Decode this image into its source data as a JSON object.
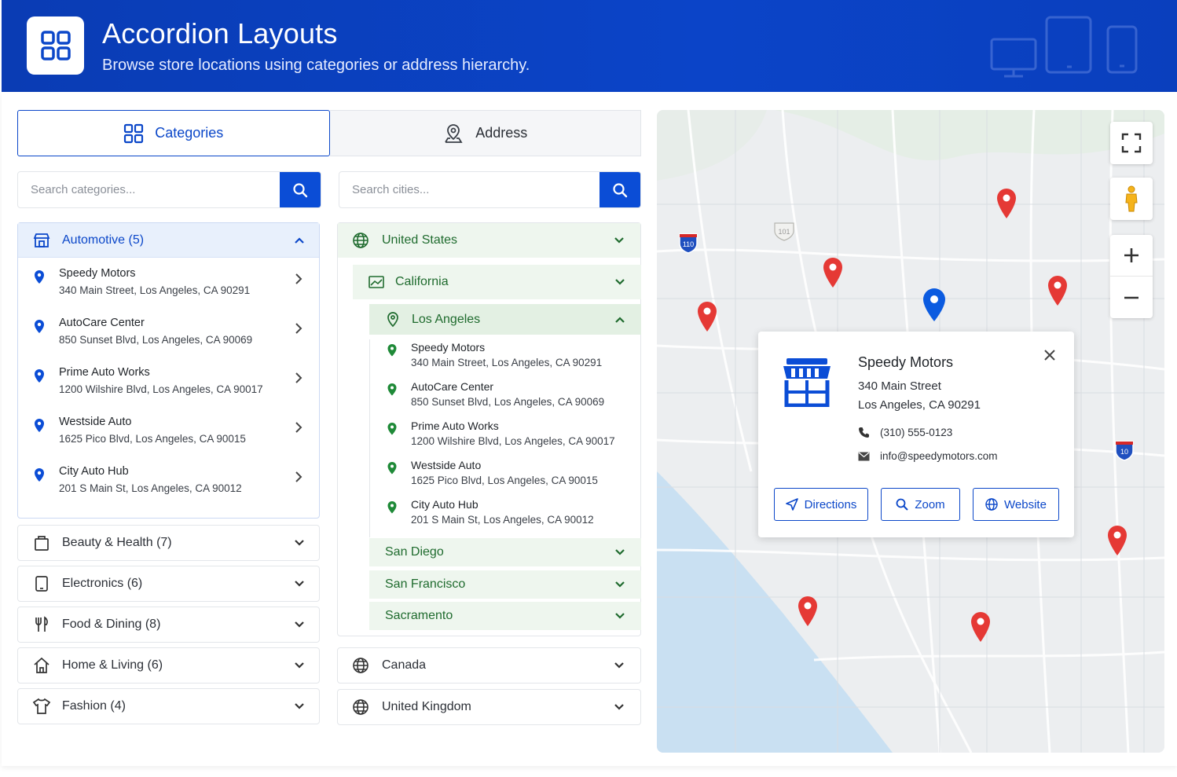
{
  "header": {
    "title": "Accordion Layouts",
    "subtitle": "Browse store locations using categories or address hierarchy."
  },
  "tabs": [
    {
      "label": "Categories",
      "icon": "grid-icon",
      "active": true
    },
    {
      "label": "Address",
      "icon": "location-person-icon",
      "active": false
    }
  ],
  "category_search": {
    "placeholder": "Search categories..."
  },
  "city_search": {
    "placeholder": "Search cities..."
  },
  "categories": [
    {
      "label": "Automotive (5)",
      "icon": "store-icon",
      "open": true,
      "stores": [
        {
          "name": "Speedy Motors",
          "address": "340 Main Street, Los Angeles, CA 90291"
        },
        {
          "name": "AutoCare Center",
          "address": "850 Sunset Blvd, Los Angeles, CA 90069"
        },
        {
          "name": "Prime Auto Works",
          "address": "1200 Wilshire Blvd, Los Angeles, CA 90017"
        },
        {
          "name": "Westside Auto",
          "address": "1625 Pico Blvd, Los Angeles, CA 90015"
        },
        {
          "name": "City Auto Hub",
          "address": "201 S Main St, Los Angeles, CA 90012"
        }
      ]
    },
    {
      "label": "Beauty & Health (7)",
      "icon": "bag-icon"
    },
    {
      "label": "Electronics (6)",
      "icon": "tablet-icon"
    },
    {
      "label": "Food & Dining (8)",
      "icon": "fork-knife-icon"
    },
    {
      "label": "Home & Living (6)",
      "icon": "home-icon"
    },
    {
      "label": "Fashion (4)",
      "icon": "shirt-icon"
    }
  ],
  "address": {
    "country_open": "United States",
    "state_open": "California",
    "city_open": "Los Angeles",
    "city_stores": [
      {
        "name": "Speedy Motors",
        "address": "340 Main Street, Los Angeles, CA 90291"
      },
      {
        "name": "AutoCare Center",
        "address": "850 Sunset Blvd, Los Angeles, CA 90069"
      },
      {
        "name": "Prime Auto Works",
        "address": "1200 Wilshire Blvd, Los Angeles, CA 90017"
      },
      {
        "name": "Westside Auto",
        "address": "1625 Pico Blvd, Los Angeles, CA 90015"
      },
      {
        "name": "City Auto Hub",
        "address": "201 S Main St, Los Angeles, CA 90012"
      }
    ],
    "other_cities": [
      "San Diego",
      "San Francisco",
      "Sacramento"
    ],
    "other_countries": [
      "Canada",
      "United Kingdom"
    ]
  },
  "map": {
    "highway_labels": [
      "110",
      "101",
      "10"
    ],
    "popup": {
      "name": "Speedy Motors",
      "address_line1": "340 Main Street",
      "address_line2": "Los Angeles, CA 90291",
      "phone": "(310) 555-0123",
      "email": "info@speedymotors.com",
      "buttons": [
        "Directions",
        "Zoom",
        "Website"
      ]
    }
  },
  "colors": {
    "primary": "#0b47c9",
    "header_bg": "#0a3fbd",
    "green": "#1f7a34",
    "pin_red": "#e53935",
    "pin_blue": "#0b5be0"
  }
}
